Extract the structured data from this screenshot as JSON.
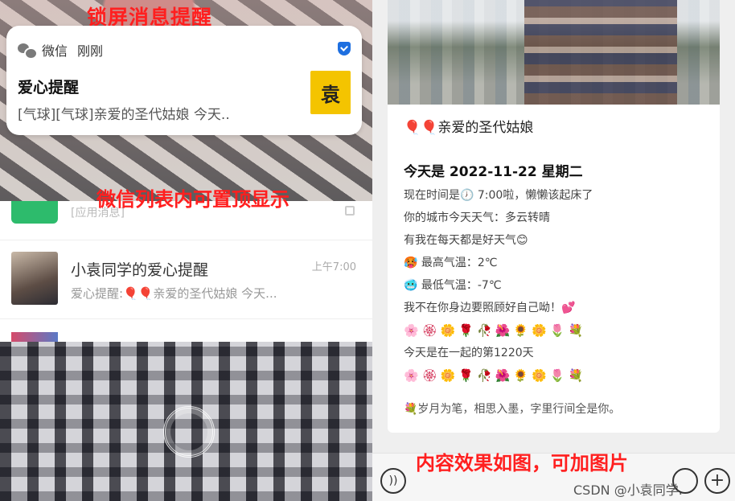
{
  "left": {
    "lock_caption": "锁屏消息提醒",
    "notification": {
      "app_name": "微信",
      "time": "刚刚",
      "title": "爱心提醒",
      "body": "[气球][气球]亲爱的圣代姑娘  今天..",
      "thumb_text": "袁"
    },
    "list_caption": "微信列表内可置顶显示",
    "chat_list": {
      "app_row_label": "[应用消息]",
      "chat": {
        "name": "小袁同学的爱心提醒",
        "time": "上午7:00",
        "preview": "爱心提醒:🎈🎈亲爱的圣代姑娘  今天..."
      }
    }
  },
  "right": {
    "message": {
      "title": "🎈🎈亲爱的圣代姑娘",
      "date_line": "今天是 2022-11-22 星期二",
      "lines": [
        "现在时间是🕖 7:00啦，懒懒该起床了",
        "你的城市今天天气：多云转晴",
        "有我在每天都是好天气😊",
        "🥵 最高气温：2℃",
        "🥶 最低气温：-7℃",
        "我不在你身边要照顾好自己呦！💕"
      ],
      "flowers_1": "🌸🏵🌼🌹🥀🌺🌻🌼🌷💐",
      "together_line": "今天是在一起的第1220天",
      "flowers_2": "🌸🏵🌼🌹🥀🌺🌻🌼🌷💐",
      "signature": "💐岁月为笔，相思入墨，字里行间全是你。"
    },
    "content_caption": "内容效果如图，可加图片",
    "watermark": "CSDN @小袁同学."
  },
  "icons": [
    "wechat-icon",
    "verify-icon",
    "fingerprint-icon",
    "voice-icon",
    "emoji-icon",
    "plus-icon"
  ]
}
